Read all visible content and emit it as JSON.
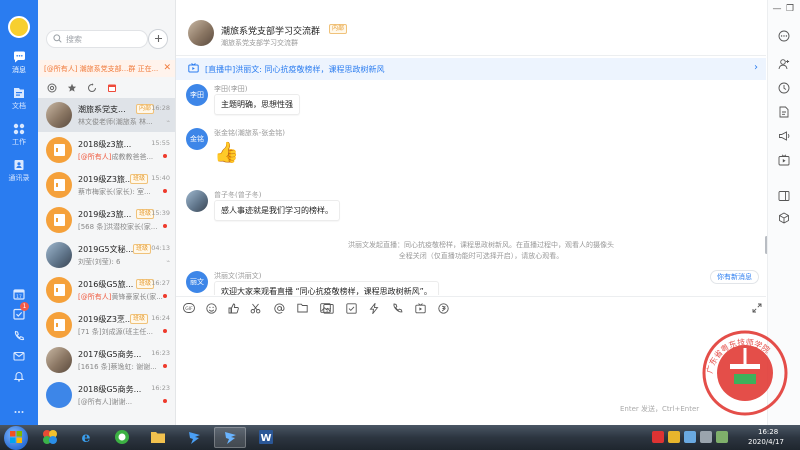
{
  "nav": {
    "items": [
      {
        "label": "消息",
        "icon": "chat-bubble-icon"
      },
      {
        "label": "文档",
        "icon": "document-icon"
      },
      {
        "label": "工作",
        "icon": "apps-grid-icon"
      },
      {
        "label": "通讯录",
        "icon": "contacts-icon"
      }
    ],
    "badge": "1"
  },
  "search": {
    "placeholder": "搜索"
  },
  "notice": {
    "text": "[@所有人] 潮旅系党支部...群 正在..."
  },
  "conversations": [
    {
      "name": "潮旅系党支...",
      "tag": "内部",
      "time": "16:28",
      "preview": "林文俊老师(潮旅系 林...",
      "avatar": "photo",
      "selected": true
    },
    {
      "name": "2018级z3旅...",
      "tag": "",
      "time": "15:55",
      "preview_at": "[@所有人]",
      "preview": "成教教爸爸...",
      "avatar": "doc",
      "unread": true
    },
    {
      "name": "2019级Z3旅...",
      "tag": "班级",
      "time": "15:40",
      "preview": "蔡市梅家长(家长): 室...",
      "avatar": "doc",
      "unread": true
    },
    {
      "name": "2019级z3旅...",
      "tag": "班级",
      "time": "15:39",
      "preview": "[568 条]洪潜校家长(家...",
      "avatar": "doc",
      "unread": true
    },
    {
      "name": "2019G5文秘...",
      "tag": "班级",
      "time": "04:13",
      "preview": "刘莹(刘莹): 6",
      "avatar": "photo2",
      "unread": false
    },
    {
      "name": "2016级G5旅...",
      "tag": "班级",
      "time": "16:27",
      "preview_at": "[@所有人]",
      "preview": "黄锋豪家长(家...",
      "avatar": "doc",
      "unread": true
    },
    {
      "name": "2019级Z3烹...",
      "tag": "班级",
      "time": "16:24",
      "preview": "[71 条]刘成源(班主任...",
      "avatar": "doc",
      "unread": true
    },
    {
      "name": "2017级G5商务...",
      "tag": "",
      "time": "16:23",
      "preview": "[1616 条]蔡逸虹: 谢谢...",
      "avatar": "photo",
      "unread": true
    },
    {
      "name": "2018级G5商务...",
      "tag": "",
      "time": "16:23",
      "preview": "[@所有人]谢谢...",
      "avatar": "blue",
      "unread": true
    }
  ],
  "chat": {
    "title": "潮旅系党支部学习交流群",
    "tag": "内部",
    "subtitle": "潮旅系党支部学习交流群",
    "live_banner": "[直播中]洪丽文: 同心抗疫敬榜样，课程思政树新风"
  },
  "messages": [
    {
      "avatar_text": "李田",
      "sender": "李田(李田)",
      "text": "主题明确，思想性强"
    },
    {
      "avatar_text": "金铭",
      "sender": "张金铭(潮旅系-张金铭)",
      "text": "👍"
    },
    {
      "avatar_text": "",
      "sender": "曾子冬(曾子冬)",
      "text": "感人事迹就是我们学习的榜样。"
    },
    {
      "avatar_text": "丽文",
      "sender": "洪丽文(洪丽文)",
      "text": "欢迎大家来观看直播 “同心抗疫敬榜样，课程思政树新风”。"
    }
  ],
  "system_note": "洪丽文发起直播：同心抗疫敬榜样，课程思政树新风。在直播过程中，观看人的摄像头全程关闭（仅直播功能时可选择开启），请放心观看。",
  "new_message_hint": "你有新消息",
  "send_hint": "Enter 发送，Ctrl+Enter",
  "seal": {
    "outer_text": "广东省粤东技师学院",
    "inner_text": "广东省粤东技师学院"
  },
  "taskbar": {
    "time": "16:28",
    "date": "2020/4/17"
  },
  "colors": {
    "brand": "#2a7cf0",
    "unread": "#ee3a2c",
    "tag": "#e69a2e",
    "at_mention": "#f0593e",
    "seal": "#e23b36"
  }
}
